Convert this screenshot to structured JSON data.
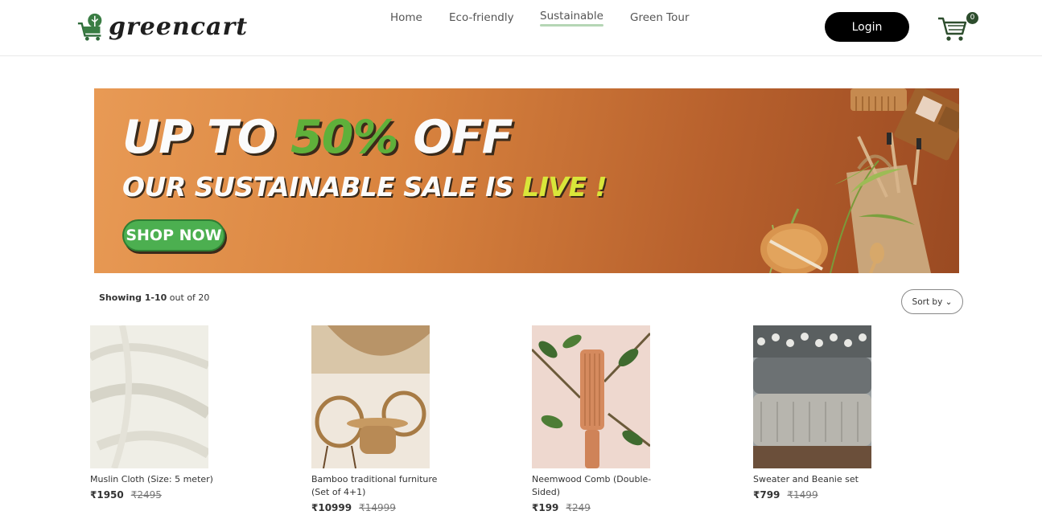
{
  "header": {
    "logo_text": "greencart",
    "nav": [
      {
        "label": "Home",
        "active": false
      },
      {
        "label": "Eco-friendly",
        "active": false
      },
      {
        "label": "Sustainable",
        "active": true
      },
      {
        "label": "Green Tour",
        "active": false
      }
    ],
    "login_label": "Login",
    "cart_count": "0"
  },
  "banner": {
    "line1_a": "UP TO ",
    "line1_b": "50%",
    "line1_c": " OFF",
    "line2_a": "OUR SUSTAINABLE SALE IS ",
    "line2_b": "LIVE !",
    "cta": "SHOP NOW"
  },
  "listing": {
    "showing_bold": "Showing 1-10",
    "showing_rest": " out of 20",
    "sort_label": "Sort by"
  },
  "products": [
    {
      "name": "Muslin Cloth (Size: 5 meter)",
      "price": "₹1950",
      "old_price": "₹2495",
      "image": "white muslin cloth"
    },
    {
      "name": "Bamboo traditional furniture (Set of 4+1)",
      "price": "₹10999",
      "old_price": "₹14999",
      "image": "rattan chairs and table"
    },
    {
      "name": "Neemwood Comb (Double-Sided)",
      "price": "₹199",
      "old_price": "₹249",
      "image": "wooden comb with leaves"
    },
    {
      "name": "Sweater and Beanie set",
      "price": "₹799",
      "old_price": "₹1499",
      "image": "stack of knit sweaters"
    }
  ],
  "colors": {
    "accent_green": "#4caf50",
    "nav_underline": "#b5d6b5",
    "banner_orange": "#d9843f",
    "badge": "#2d4d2d"
  }
}
